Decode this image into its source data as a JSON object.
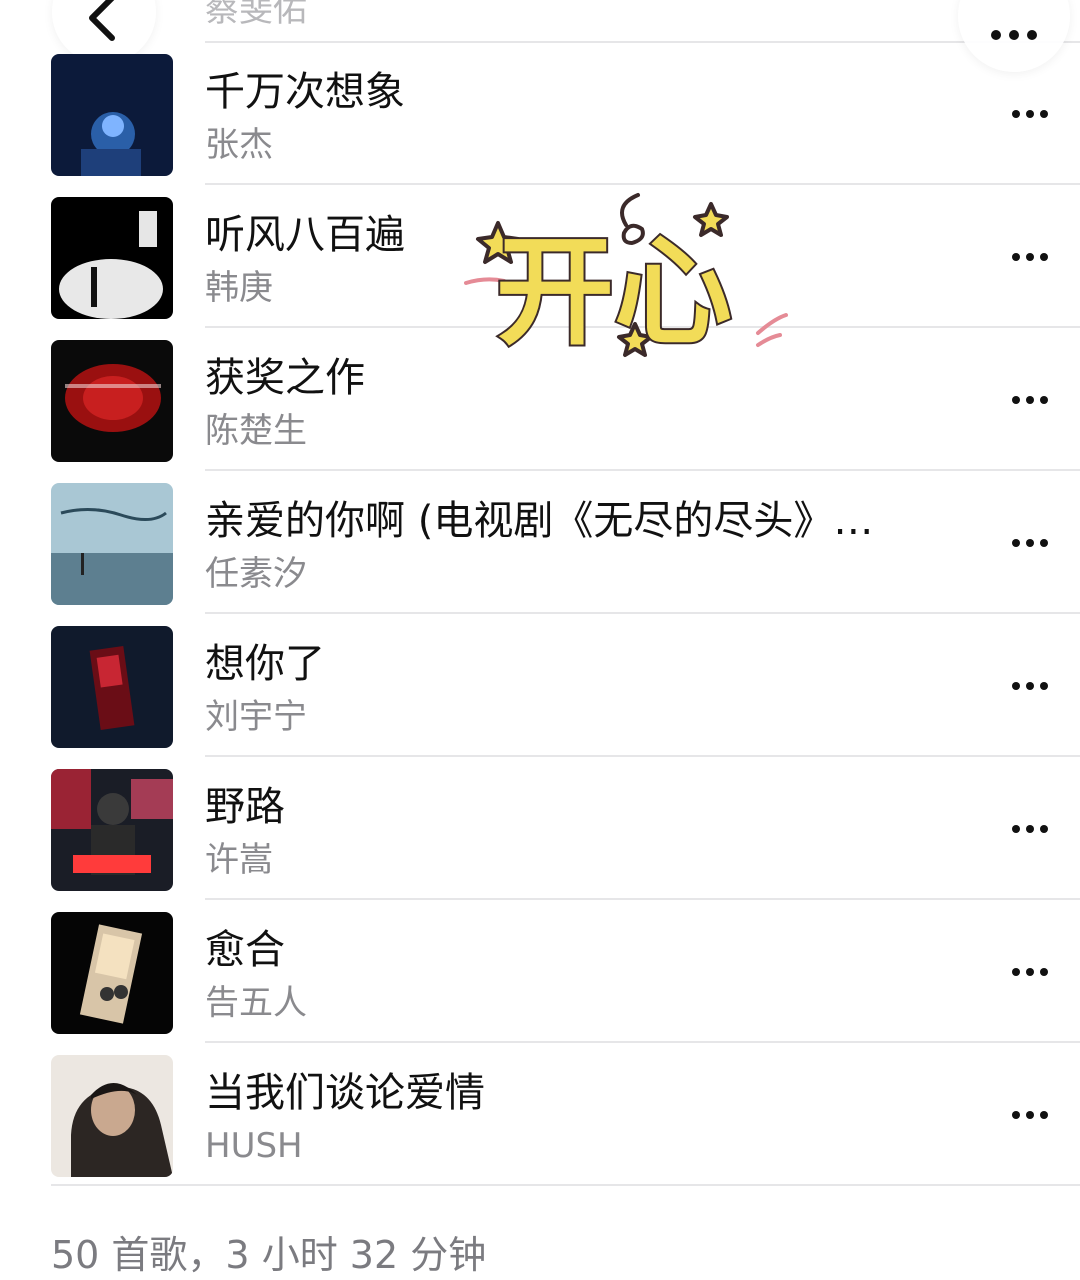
{
  "top_partial": {
    "artist": "蔡斐佑"
  },
  "songs": [
    {
      "title": "千万次想象",
      "artist": "张杰"
    },
    {
      "title": "听风八百遍",
      "artist": "韩庚"
    },
    {
      "title": "获奖之作",
      "artist": "陈楚生"
    },
    {
      "title": "亲爱的你啊 (电视剧《无尽的尽头》…",
      "artist": "任素汐"
    },
    {
      "title": "想你了",
      "artist": "刘宇宁"
    },
    {
      "title": "野路",
      "artist": "许嵩"
    },
    {
      "title": "愈合",
      "artist": "告五人"
    },
    {
      "title": "当我们谈论爱情",
      "artist": "HUSH"
    }
  ],
  "sticker": {
    "text": "开心"
  },
  "footer": {
    "summary": "50 首歌，3 小时 32 分钟"
  },
  "icons": {
    "back": "chevron-left-icon",
    "more": "ellipsis-icon"
  }
}
